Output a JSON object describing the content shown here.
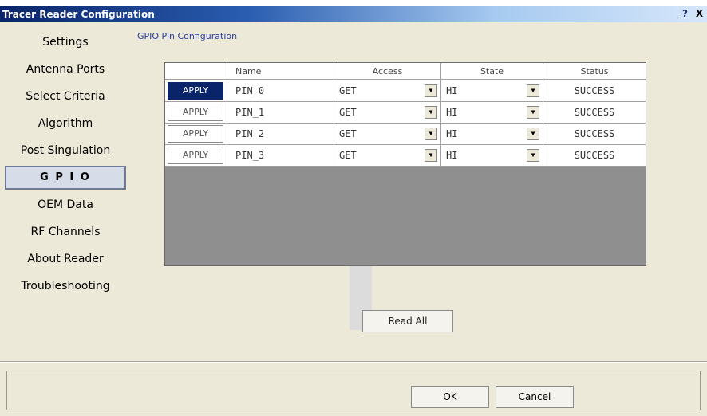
{
  "window": {
    "title": "Tracer Reader Configuration",
    "help_glyph": "?",
    "close_glyph": "X"
  },
  "sidebar": {
    "items": [
      {
        "label": "Settings"
      },
      {
        "label": "Antenna Ports"
      },
      {
        "label": "Select Criteria"
      },
      {
        "label": "Algorithm"
      },
      {
        "label": "Post Singulation"
      },
      {
        "label": "G P I O",
        "active": true
      },
      {
        "label": "OEM Data"
      },
      {
        "label": "RF Channels"
      },
      {
        "label": "About Reader"
      },
      {
        "label": "Troubleshooting"
      }
    ]
  },
  "main": {
    "heading": "GPIO Pin Configuration",
    "table": {
      "headers": [
        "",
        "Name",
        "Access",
        "State",
        "Status"
      ],
      "rows": [
        {
          "apply": "APPLY",
          "name": "PIN_0",
          "access": "GET",
          "state": "HI",
          "status": "SUCCESS"
        },
        {
          "apply": "APPLY",
          "name": "PIN_1",
          "access": "GET",
          "state": "HI",
          "status": "SUCCESS"
        },
        {
          "apply": "APPLY",
          "name": "PIN_2",
          "access": "GET",
          "state": "HI",
          "status": "SUCCESS"
        },
        {
          "apply": "APPLY",
          "name": "PIN_3",
          "access": "GET",
          "state": "HI",
          "status": "SUCCESS"
        }
      ]
    },
    "read_all_label": "Read All"
  },
  "footer": {
    "ok_label": "OK",
    "cancel_label": "Cancel"
  },
  "colors": {
    "titlebar_dark": "#0a246a",
    "titlebar_light": "#a6caf0",
    "dialog_bg": "#ece9d8",
    "grid_bg": "#8f8f8f",
    "heading_text": "#2b3fa6",
    "apply_active": "#0a246a"
  }
}
